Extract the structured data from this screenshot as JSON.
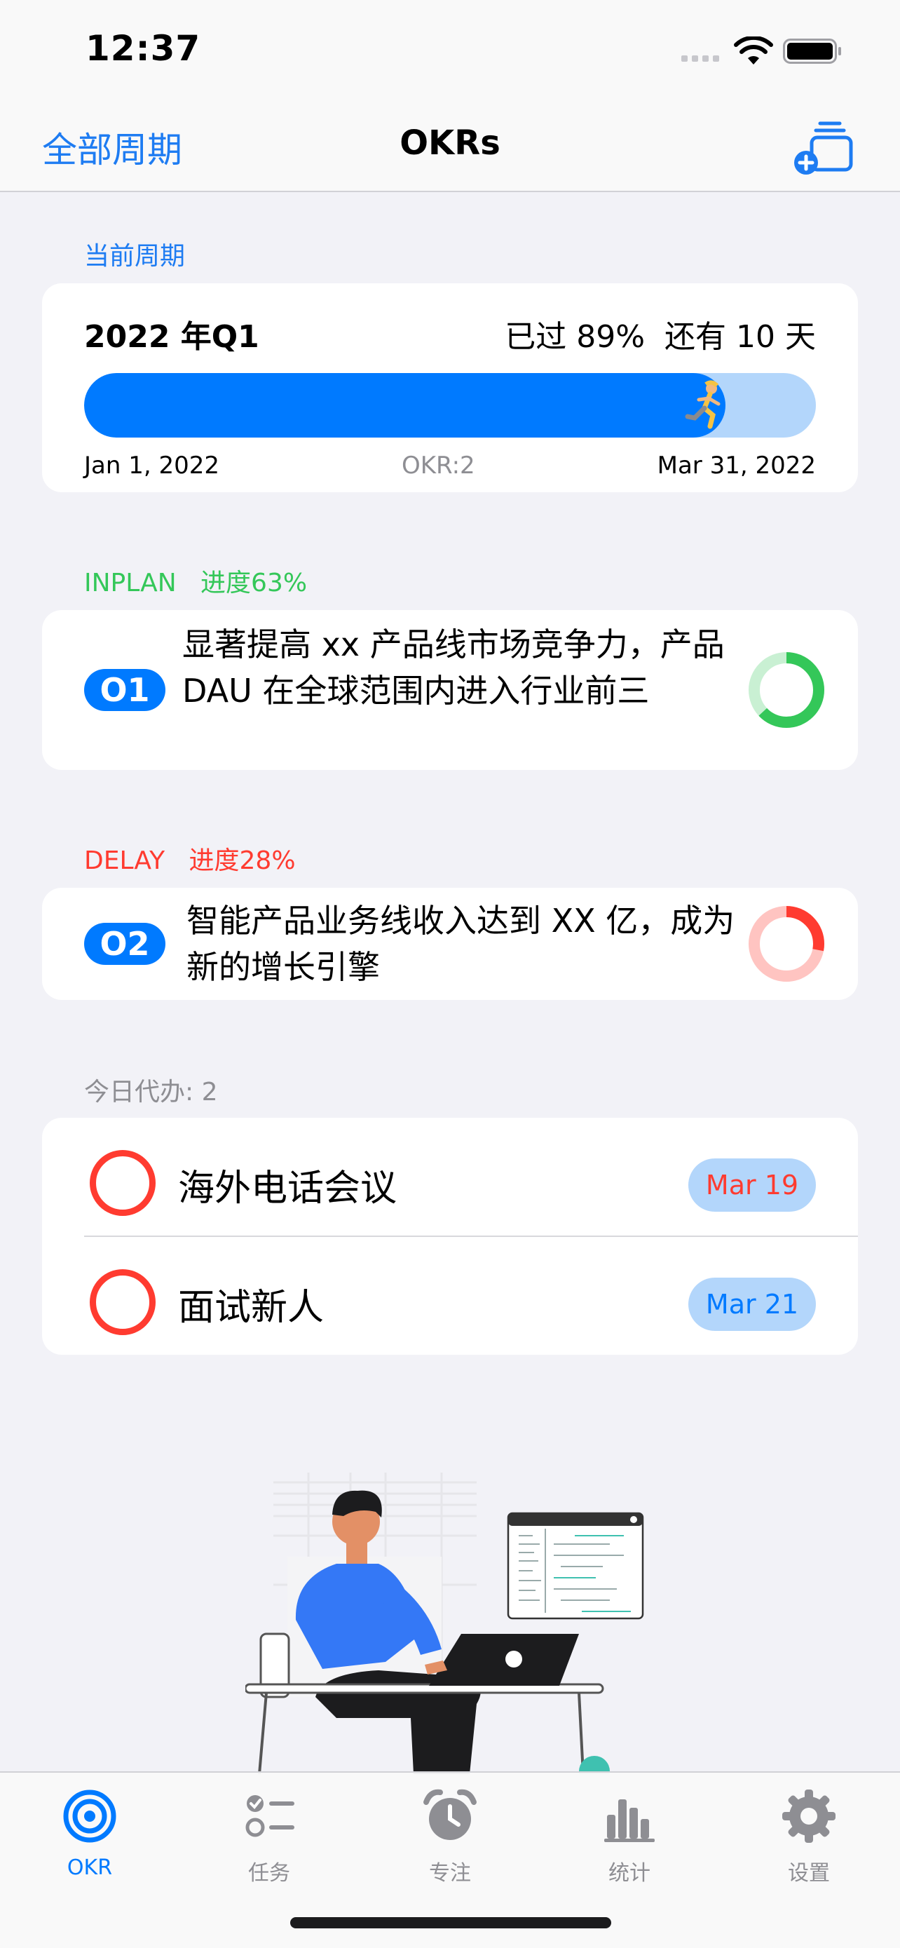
{
  "status_bar": {
    "time": "12:37"
  },
  "nav": {
    "left_label": "全部周期",
    "title": "OKRs",
    "add_icon": "add-stack-icon"
  },
  "current_period": {
    "section_label": "当前周期",
    "title": "2022 年Q1",
    "elapsed": "已过 89%",
    "remaining": "还有 10 天",
    "progress": 0.89,
    "start_date": "Jan 1, 2022",
    "okr_count": "OKR:2",
    "end_date": "Mar 31, 2022"
  },
  "objectives": [
    {
      "status": "INPLAN",
      "progress_label": "进度63%",
      "progress": 0.63,
      "badge": "O1",
      "text": "显著提高 xx 产品线市场竞争力，产品 DAU 在全球范围内进入行业前三",
      "color": "#34C759",
      "track_color": "#C9F0D3"
    },
    {
      "status": "DELAY",
      "progress_label": "进度28%",
      "progress": 0.28,
      "badge": "O2",
      "text": "智能产品业务线收入达到 XX 亿，成为新的增长引擎",
      "color": "#FF3B30",
      "track_color": "#FFC4C1"
    }
  ],
  "todo": {
    "section_label": "今日代办: 2",
    "items": [
      {
        "title": "海外电话会议",
        "date": "Mar 19",
        "date_color": "#FF3B30"
      },
      {
        "title": "面试新人",
        "date": "Mar 21",
        "date_color": "#007AFF"
      }
    ]
  },
  "tabs": [
    {
      "label": "OKR",
      "icon": "target-icon",
      "active": true
    },
    {
      "label": "任务",
      "icon": "checklist-icon",
      "active": false
    },
    {
      "label": "专注",
      "icon": "alarm-clock-icon",
      "active": false
    },
    {
      "label": "统计",
      "icon": "bar-chart-icon",
      "active": false
    },
    {
      "label": "设置",
      "icon": "gear-icon",
      "active": false
    }
  ],
  "colors": {
    "accent": "#007AFF",
    "link": "#1E7CF2",
    "inplan": "#34C759",
    "delay": "#FF3B30",
    "background": "#F2F2F7"
  }
}
